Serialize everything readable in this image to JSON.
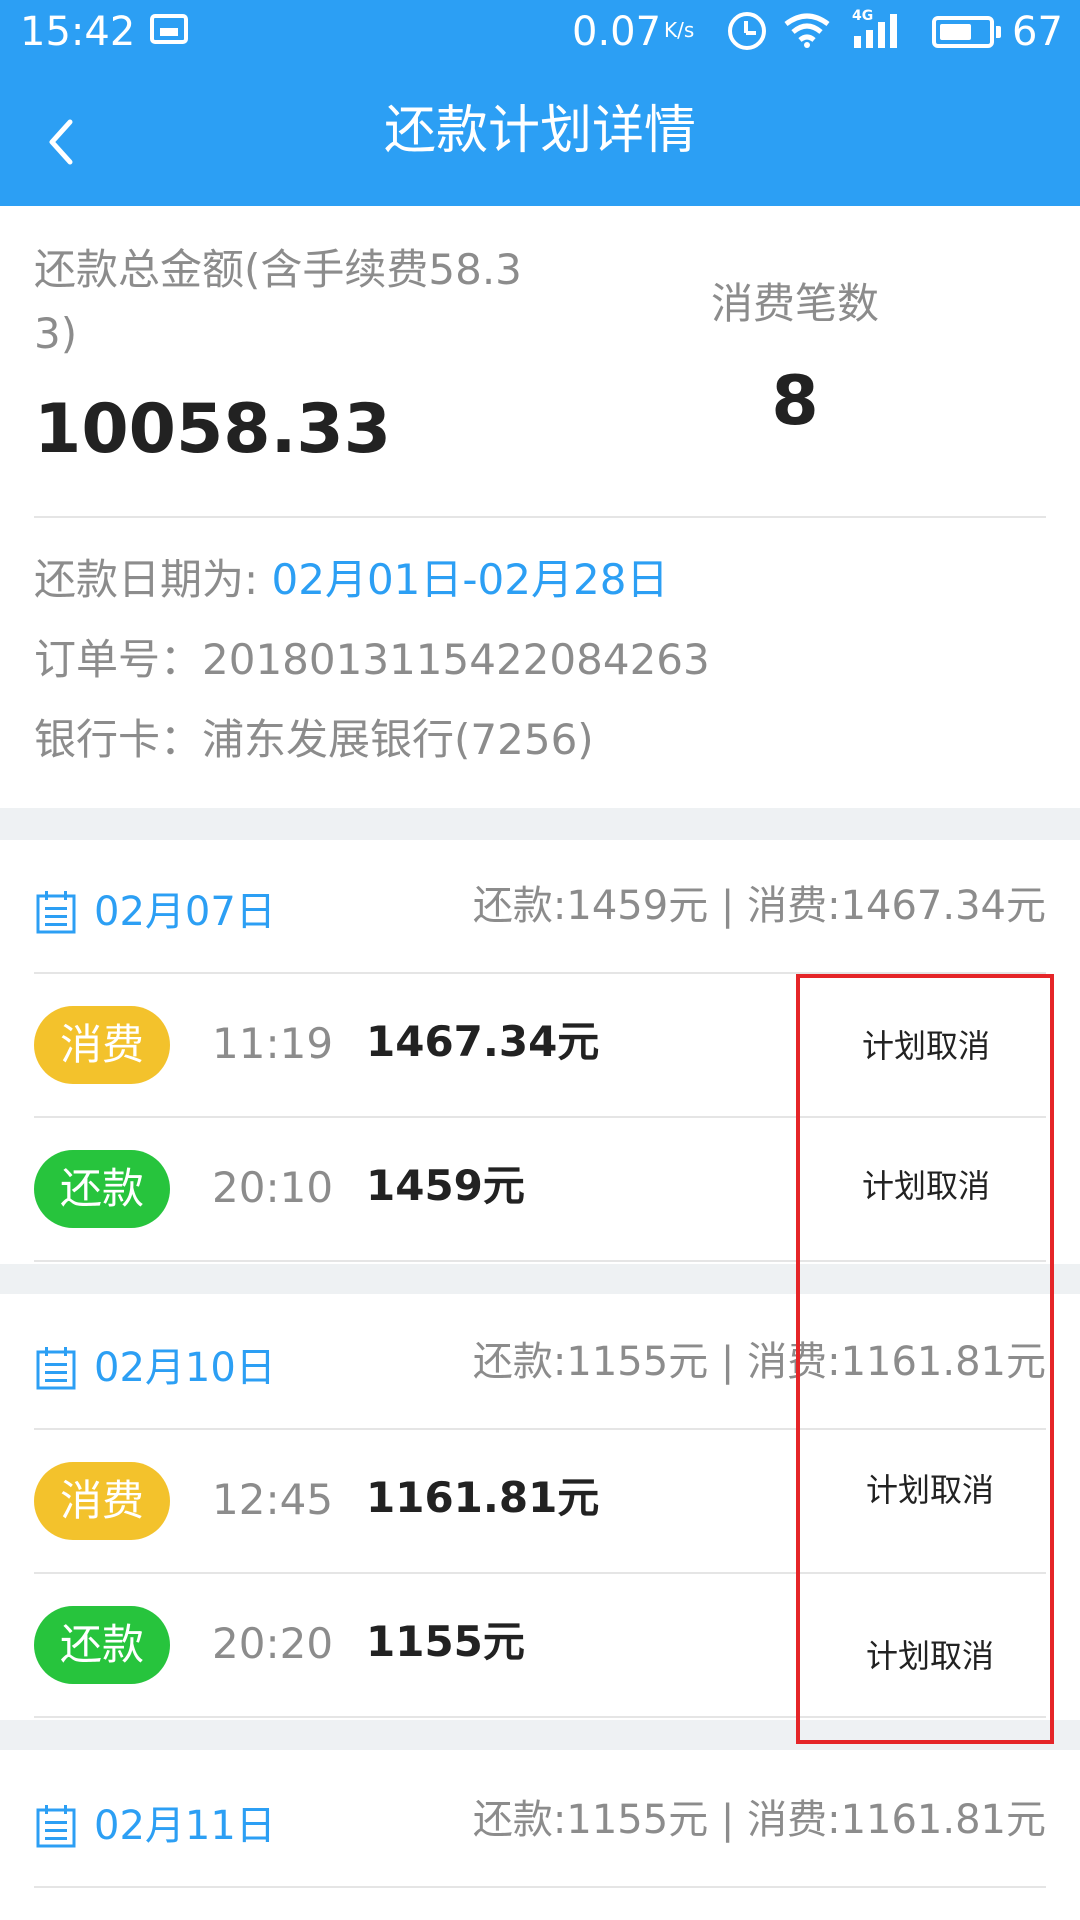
{
  "status_bar": {
    "time": "15:42",
    "net_speed": "0.07",
    "net_unit": "K/s",
    "network_type": "4G",
    "battery_level": "67",
    "icons": [
      "image-icon",
      "alarm-icon",
      "wifi-icon",
      "signal-icon",
      "battery-icon"
    ]
  },
  "header": {
    "title": "还款计划详情",
    "back_icon": "chevron-left-icon"
  },
  "summary": {
    "total_label": "还款总金额(含手续费58.33)",
    "total_amount": "10058.33",
    "count_label": "消费笔数",
    "count_value": "8"
  },
  "info": {
    "date_label": "还款日期为: ",
    "date_range": "02月01日-02月28日",
    "order_label": "订单号：",
    "order_no": "20180131154220842​63",
    "card_label": "银行卡：",
    "card_value": "浦东发展银行(7256)"
  },
  "groups": [
    {
      "date": "02月07日",
      "summary": "还款:1459元 | 消费:1467.34元",
      "items": [
        {
          "type": "消费",
          "kind": "spend",
          "time": "11:19",
          "amount": "1467.34元",
          "status": "计划取消"
        },
        {
          "type": "还款",
          "kind": "repay",
          "time": "20:10",
          "amount": "1459元",
          "status": "计划取消"
        }
      ]
    },
    {
      "date": "02月10日",
      "summary": "还款:1155元 | 消费:1161.81元",
      "items": [
        {
          "type": "消费",
          "kind": "spend",
          "time": "12:45",
          "amount": "1161.81元",
          "status": "计划取消"
        },
        {
          "type": "还款",
          "kind": "repay",
          "time": "20:20",
          "amount": "1155元",
          "status": "计划取消"
        }
      ]
    },
    {
      "date": "02月11日",
      "summary": "还款:1155元 | 消费:1161.81元",
      "items": []
    }
  ],
  "colors": {
    "brand_blue": "#2c9ff4",
    "spend_badge": "#f3c22c",
    "repay_badge": "#27c43d",
    "highlight_frame": "#e52528"
  }
}
